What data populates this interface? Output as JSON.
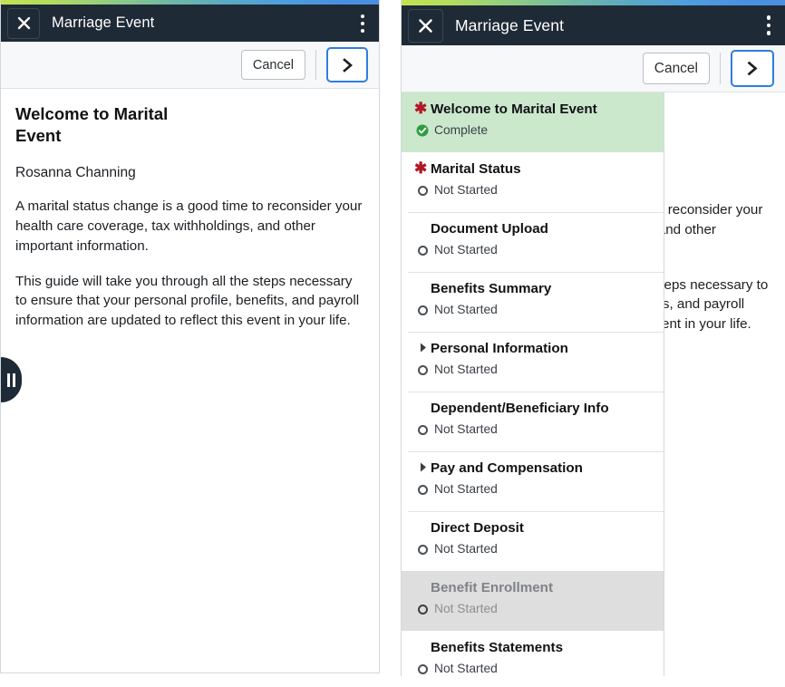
{
  "app": {
    "title": "Marriage Event",
    "close_icon": "close-x-icon",
    "menu_icon": "kebab-menu-icon"
  },
  "toolbar": {
    "cancel_label": "Cancel",
    "next_icon": "chevron-right-icon"
  },
  "content": {
    "heading": "Welcome to Marital Event",
    "person_name": "Rosanna Channing",
    "paragraph1": "A marital status change is a good time to reconsider your health care coverage, tax withholdings, and other important information.",
    "paragraph2": "This guide will take you through all the steps necessary to ensure that your personal profile, benefits, and payroll information are updated to reflect this event in your life."
  },
  "drawer": {
    "handle_icon": "drawer-toggle-handle",
    "required_marker": "✱",
    "expander_icon": "triangle-right-icon",
    "steps": [
      {
        "title": "Welcome to Marital Event",
        "status": "Complete",
        "status_icon": "check-circle-icon",
        "required": true,
        "expandable": false,
        "state": "current"
      },
      {
        "title": "Marital Status",
        "status": "Not Started",
        "status_icon": "circle-outline-icon",
        "required": true,
        "expandable": false,
        "state": "normal"
      },
      {
        "title": "Document Upload",
        "status": "Not Started",
        "status_icon": "circle-outline-icon",
        "required": false,
        "expandable": false,
        "state": "normal"
      },
      {
        "title": "Benefits Summary",
        "status": "Not Started",
        "status_icon": "circle-outline-icon",
        "required": false,
        "expandable": false,
        "state": "normal"
      },
      {
        "title": "Personal Information",
        "status": "Not Started",
        "status_icon": "circle-outline-icon",
        "required": false,
        "expandable": true,
        "state": "normal"
      },
      {
        "title": "Dependent/Beneficiary Info",
        "status": "Not Started",
        "status_icon": "circle-outline-icon",
        "required": false,
        "expandable": false,
        "state": "normal"
      },
      {
        "title": "Pay and Compensation",
        "status": "Not Started",
        "status_icon": "circle-outline-icon",
        "required": false,
        "expandable": true,
        "state": "normal"
      },
      {
        "title": "Direct Deposit",
        "status": "Not Started",
        "status_icon": "circle-outline-icon",
        "required": false,
        "expandable": false,
        "state": "normal"
      },
      {
        "title": "Benefit Enrollment",
        "status": "Not Started",
        "status_icon": "circle-outline-icon",
        "required": false,
        "expandable": false,
        "state": "disabled"
      },
      {
        "title": "Benefits Statements",
        "status": "Not Started",
        "status_icon": "circle-outline-icon",
        "required": false,
        "expandable": false,
        "state": "normal"
      }
    ]
  },
  "colors": {
    "header_bg": "#1f2a37",
    "current_step_bg": "#cbe8cd",
    "disabled_step_bg": "#dedede",
    "required_marker": "#b01826",
    "complete_green": "#2e9b3f",
    "accent_blue": "#2f7de1"
  }
}
